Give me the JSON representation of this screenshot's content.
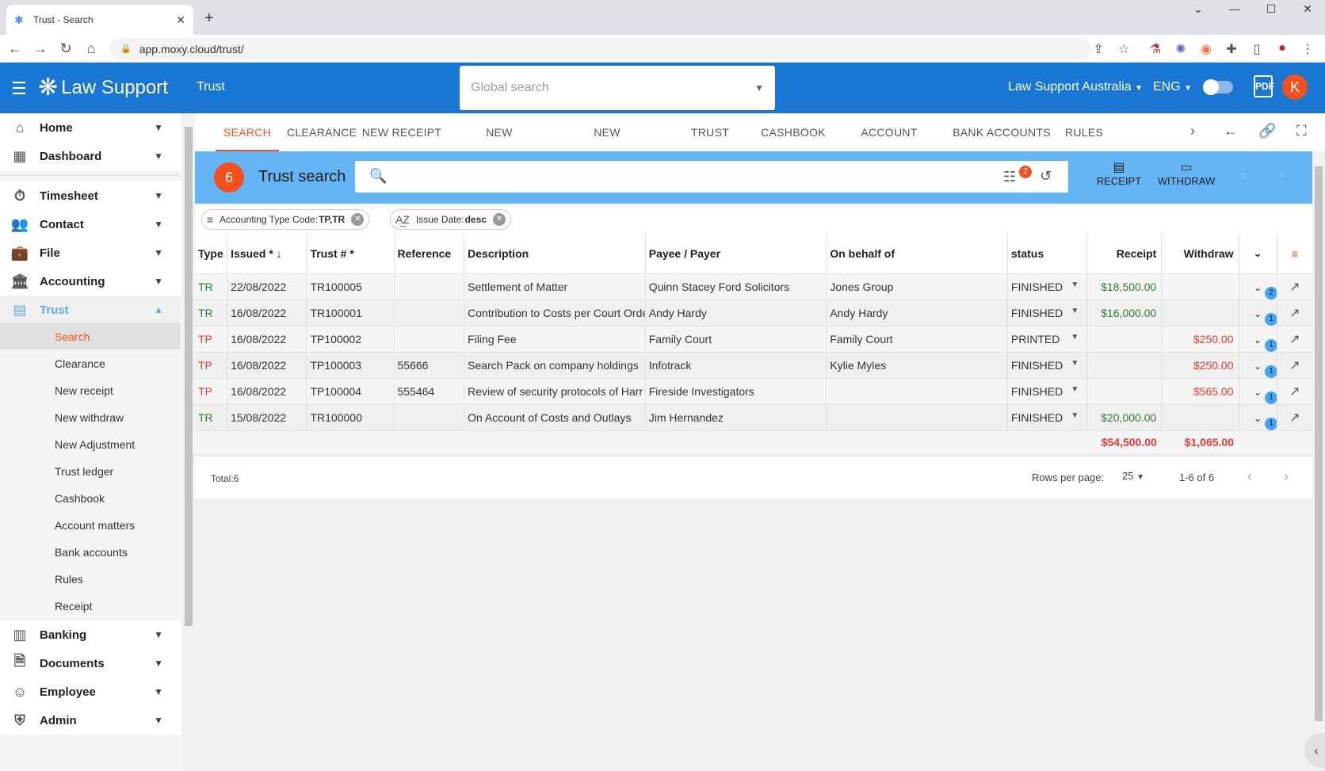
{
  "browser": {
    "tab_title": "Trust - Search",
    "url": "app.moxy.cloud/trust/"
  },
  "header": {
    "app_name": "Law Support",
    "section": "Trust",
    "global_search_placeholder": "Global search",
    "org": "Law Support Australia",
    "lang": "ENG",
    "pdf_label": "PDF",
    "avatar": "K",
    "brand_color": "#1976d2",
    "accent_color": "#f4511e"
  },
  "sidebar": {
    "items": [
      {
        "label": "Home",
        "icon": "home-icon"
      },
      {
        "label": "Dashboard",
        "icon": "dashboard-icon"
      },
      {
        "label": "Timesheet",
        "icon": "timer-icon"
      },
      {
        "label": "Contact",
        "icon": "people-icon"
      },
      {
        "label": "File",
        "icon": "briefcase-icon"
      },
      {
        "label": "Accounting",
        "icon": "bank-icon"
      },
      {
        "label": "Trust",
        "icon": "trust-icon"
      }
    ],
    "trust_sub": [
      "Search",
      "Clearance",
      "New receipt",
      "New withdraw",
      "New Adjustment",
      "Trust ledger",
      "Cashbook",
      "Account matters",
      "Bank accounts",
      "Rules",
      "Receipt"
    ],
    "bottom_items": [
      {
        "label": "Banking",
        "icon": "banking-icon"
      },
      {
        "label": "Documents",
        "icon": "document-icon"
      },
      {
        "label": "Employee",
        "icon": "employee-icon"
      },
      {
        "label": "Admin",
        "icon": "shield-icon"
      }
    ]
  },
  "tabs": [
    "SEARCH",
    "CLEARANCE",
    "NEW RECEIPT",
    "NEW WITHDRAW",
    "NEW ADJUSTMENT",
    "TRUST LEDGER",
    "CASHBOOK",
    "ACCOUNT MATTERS",
    "BANK ACCOUNTS",
    "RULES"
  ],
  "panel": {
    "count": "6",
    "title": "Trust search",
    "filter_badge": "2",
    "receipt_label": "RECEIPT",
    "withdraw_label": "WITHDRAW"
  },
  "chips": [
    {
      "label": "Accounting Type Code:",
      "value": "TP,TR"
    },
    {
      "label": "Issue Date:",
      "value": "desc"
    }
  ],
  "table": {
    "columns": [
      "Type",
      "Issued *",
      "Trust # *",
      "Reference",
      "Description",
      "Payee / Payer",
      "On behalf of",
      "status",
      "Receipt",
      "Withdraw"
    ],
    "rows": [
      {
        "type": "TR",
        "issued": "22/08/2022",
        "trust": "TR100005",
        "reference": "",
        "description": "Settlement of Matter",
        "payee": "Quinn Stacey Ford Solicitors",
        "behalf": "Jones Group",
        "status": "FINISHED",
        "receipt": "$18,500.00",
        "withdraw": "",
        "badge": "2"
      },
      {
        "type": "TR",
        "issued": "16/08/2022",
        "trust": "TR100001",
        "reference": "",
        "description": "Contribution to Costs per Court Orde",
        "payee": "Andy Hardy",
        "behalf": "Andy Hardy",
        "status": "FINISHED",
        "receipt": "$16,000.00",
        "withdraw": "",
        "badge": "1"
      },
      {
        "type": "TP",
        "issued": "16/08/2022",
        "trust": "TP100002",
        "reference": "",
        "description": "Filing Fee",
        "payee": "Family Court",
        "behalf": "Family Court",
        "status": "PRINTED",
        "receipt": "",
        "withdraw": "$250.00",
        "badge": "1"
      },
      {
        "type": "TP",
        "issued": "16/08/2022",
        "trust": "TP100003",
        "reference": "55666",
        "description": "Search Pack on company holdings",
        "payee": "Infotrack",
        "behalf": "Kylie Myles",
        "status": "FINISHED",
        "receipt": "",
        "withdraw": "$250.00",
        "badge": "1"
      },
      {
        "type": "TP",
        "issued": "16/08/2022",
        "trust": "TP100004",
        "reference": "555464",
        "description": "Review of security protocols of Harr",
        "payee": "Fireside Investigators",
        "behalf": "",
        "status": "FINISHED",
        "receipt": "",
        "withdraw": "$565.00",
        "badge": "1"
      },
      {
        "type": "TR",
        "issued": "15/08/2022",
        "trust": "TR100000",
        "reference": "",
        "description": "On Account of Costs and Outlays",
        "payee": "Jim Hernandez",
        "behalf": "",
        "status": "FINISHED",
        "receipt": "$20,000.00",
        "withdraw": "",
        "badge": "1"
      }
    ],
    "total_receipt": "$54,500.00",
    "total_withdraw": "$1,065.00"
  },
  "footer": {
    "total": "Total:6",
    "rows_per_page_label": "Rows per page:",
    "rows_per_page": "25",
    "range": "1-6 of 6"
  }
}
